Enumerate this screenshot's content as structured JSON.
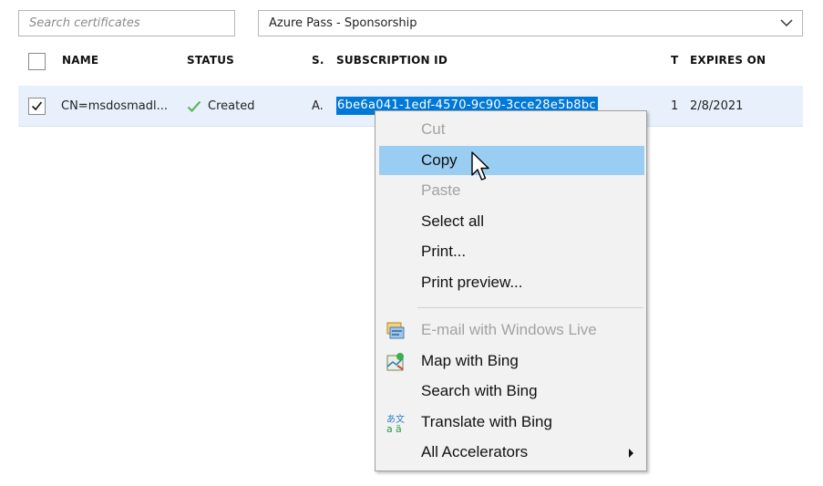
{
  "toolbar": {
    "search_placeholder": "Search certificates",
    "subscription_selected": "Azure Pass - Sponsorship"
  },
  "table": {
    "columns": [
      "NAME",
      "STATUS",
      "S.",
      "SUBSCRIPTION ID",
      "T",
      "EXPIRES ON"
    ],
    "rows": [
      {
        "selected": true,
        "name": "CN=msdosmadl...",
        "status": "Created",
        "s": "A.",
        "subscription_id": "6be6a041-1edf-4570-9c90-3cce28e5b8bc",
        "t": "1",
        "expires_on": "2/8/2021"
      }
    ]
  },
  "context_menu": {
    "items": [
      {
        "label": "Cut",
        "enabled": false
      },
      {
        "label": "Copy",
        "enabled": true,
        "highlighted": true
      },
      {
        "label": "Paste",
        "enabled": false
      },
      {
        "label": "Select all",
        "enabled": true
      },
      {
        "label": "Print...",
        "enabled": true
      },
      {
        "label": "Print preview...",
        "enabled": true
      },
      {
        "label": "E-mail with Windows Live",
        "enabled": false,
        "icon": "email-windows-live-icon"
      },
      {
        "label": "Map with Bing",
        "enabled": true,
        "icon": "map-bing-icon"
      },
      {
        "label": "Search with Bing",
        "enabled": true
      },
      {
        "label": "Translate with Bing",
        "enabled": true,
        "icon": "translate-bing-icon"
      },
      {
        "label": "All Accelerators",
        "enabled": true,
        "submenu": true
      }
    ]
  },
  "colors": {
    "selection": "#0078d7",
    "row_highlight": "#e8f1fb",
    "menu_highlight": "#99cdf2",
    "status_check": "#5cb85c"
  }
}
